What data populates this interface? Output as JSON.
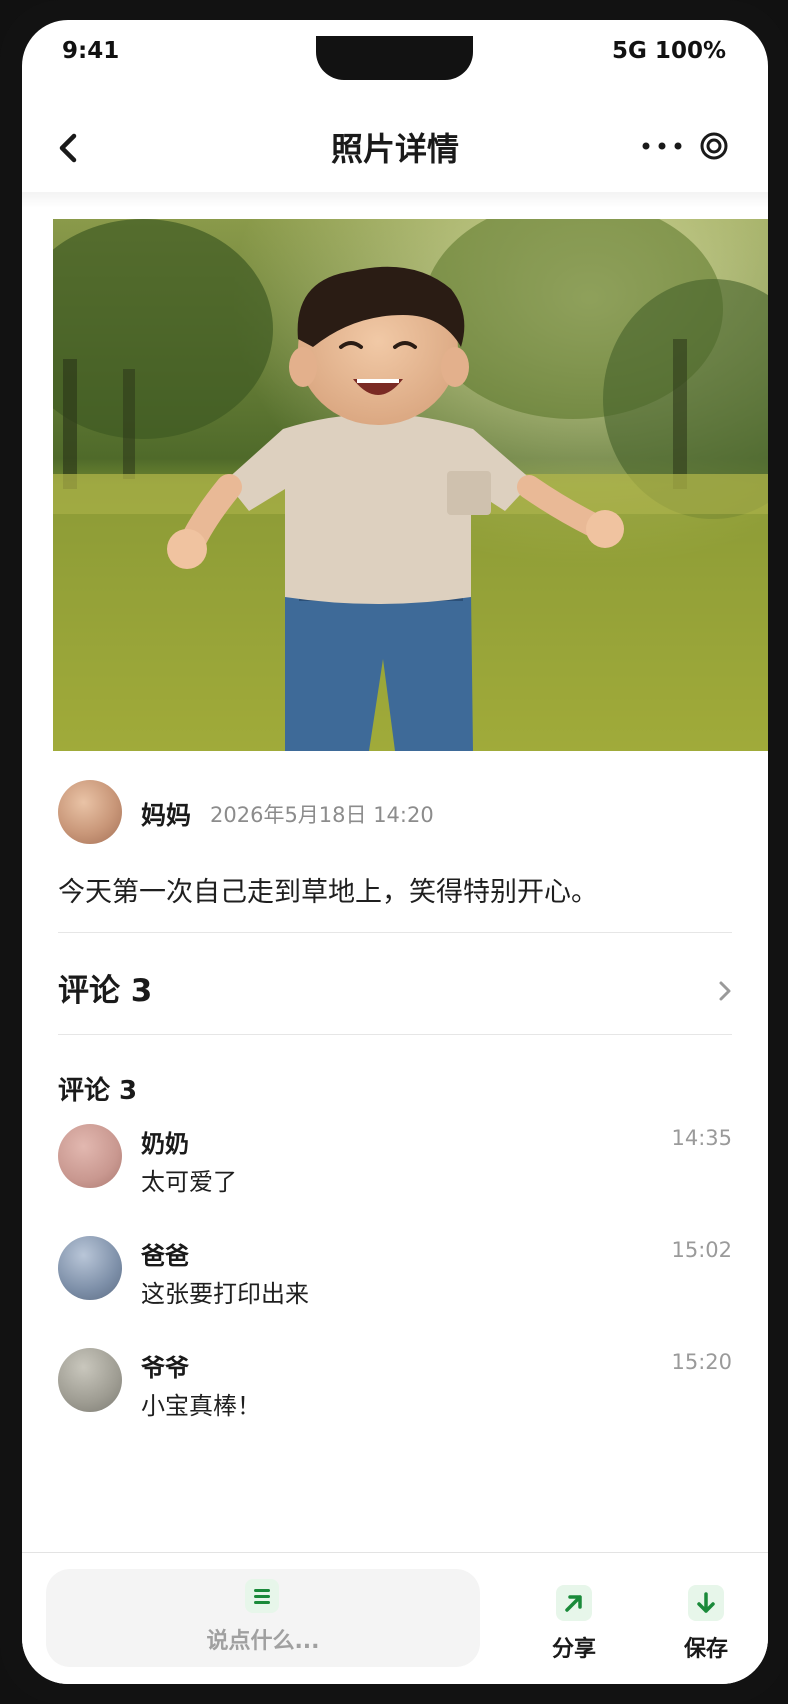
{
  "status_bar": {
    "time": "9:41",
    "network": "5G 100%"
  },
  "nav": {
    "title": "照片详情"
  },
  "post": {
    "author": "妈妈",
    "timestamp": "2026年5月18日 14:20",
    "caption": "今天第一次自己走到草地上，笑得特别开心。"
  },
  "comments_link": {
    "label": "评论 3"
  },
  "comments_section": {
    "title": "评论 3",
    "items": [
      {
        "name": "奶奶",
        "text": "太可爱了",
        "time": "14:35",
        "avatar_color": "#c99890"
      },
      {
        "name": "爸爸",
        "text": "这张要打印出来",
        "time": "15:02",
        "avatar_color": "#7d8fa8"
      },
      {
        "name": "爷爷",
        "text": "小宝真棒！",
        "time": "15:20",
        "avatar_color": "#9e9c92"
      }
    ]
  },
  "bottom_bar": {
    "input_placeholder": "说点什么...",
    "share_label": "分享",
    "save_label": "保存"
  },
  "colors": {
    "accent_green": "#1a8a3a",
    "icon_bg": "#e7f6ea"
  },
  "icons": [
    "back-icon",
    "more-icon",
    "target-icon",
    "chevron-right-icon",
    "menu-icon",
    "share-arrow-icon",
    "download-arrow-icon"
  ]
}
